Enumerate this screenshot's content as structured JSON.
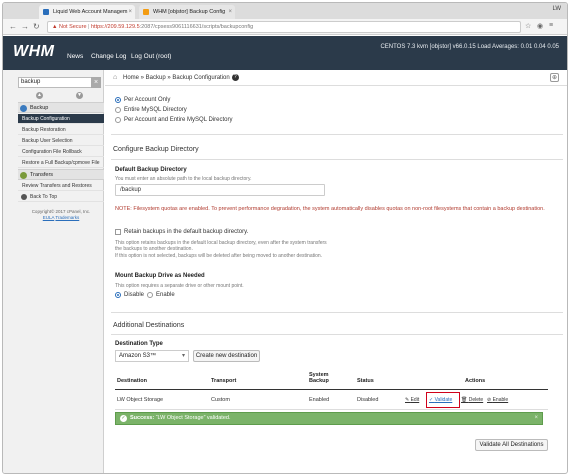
{
  "browser": {
    "tabs": [
      {
        "label": "Liquid Web Account Managem",
        "fav_color": "#2a6ebb"
      },
      {
        "label": "WHM [objstor] Backup Config",
        "fav_color": "#f39c12"
      }
    ],
    "window_label": "LW",
    "not_secure": "Not Secure",
    "url_host": "https://209.59.129.5",
    "url_path": ":2087/cpsess9061116631/scripts/backupconfig"
  },
  "header": {
    "logo": "WHM",
    "nav": [
      "News",
      "Change Log",
      "Log Out (root)"
    ],
    "server_info": "CENTOS 7.3 kvm [objstor]   v66.0.15   Load Averages: 0.01 0.04 0.05"
  },
  "sidebar": {
    "search_value": "backup",
    "section_backup": "Backup",
    "backup_items": [
      "Backup Configuration",
      "Backup Restoration",
      "Backup User Selection",
      "Configuration File Rollback",
      "Restore a Full Backup/cpmove File"
    ],
    "section_transfers": "Transfers",
    "transfer_items": [
      "Review Transfers and Restores"
    ],
    "back_to_top": "Back To Top",
    "copyright": "Copyright© 2017 cPanel, Inc.",
    "eula": "EULA",
    "trademarks": "Trademarks"
  },
  "breadcrumb": "Home » Backup » Backup Configuration",
  "backup_type": {
    "options": [
      "Per Account Only",
      "Entire MySQL Directory",
      "Per Account and Entire MySQL Directory"
    ],
    "selected_index": 0
  },
  "configure_dir": {
    "heading": "Configure Backup Directory",
    "default_label": "Default Backup Directory",
    "default_help": "You must enter an absolute path to the local backup directory.",
    "default_value": "/backup",
    "note": "NOTE: Filesystem quotas are enabled. To prevent performance degradation, the system automatically disables quotas on non-root filesystems that contain a backup destination.",
    "retain_label": "Retain backups in the default backup directory.",
    "retain_help_1": "This option retains backups in the default local backup directory, even after the system transfers the backups to another destination.",
    "retain_help_2": "If this option is not selected, backups will be deleted after being moved to another destination.",
    "mount_label": "Mount Backup Drive as Needed",
    "mount_help": "This option requires a separate drive or other mount point.",
    "mount_options": [
      "Disable",
      "Enable"
    ]
  },
  "additional": {
    "heading": "Additional Destinations",
    "dest_type_label": "Destination Type",
    "dest_type_value": "Amazon S3™",
    "create_button": "Create new destination",
    "columns": [
      "Destination",
      "Transport",
      "System Backup",
      "Status",
      "Actions"
    ],
    "rows": [
      {
        "destination": "LW Object Storage",
        "transport": "Custom",
        "system_backup": "Enabled",
        "status": "Disabled"
      }
    ],
    "actions": [
      "Edit",
      "Validate",
      "Delete",
      "Enable"
    ],
    "success_prefix": "Success:",
    "success_message": "“LW Object Storage” validated.",
    "validate_all": "Validate All Destinations"
  }
}
